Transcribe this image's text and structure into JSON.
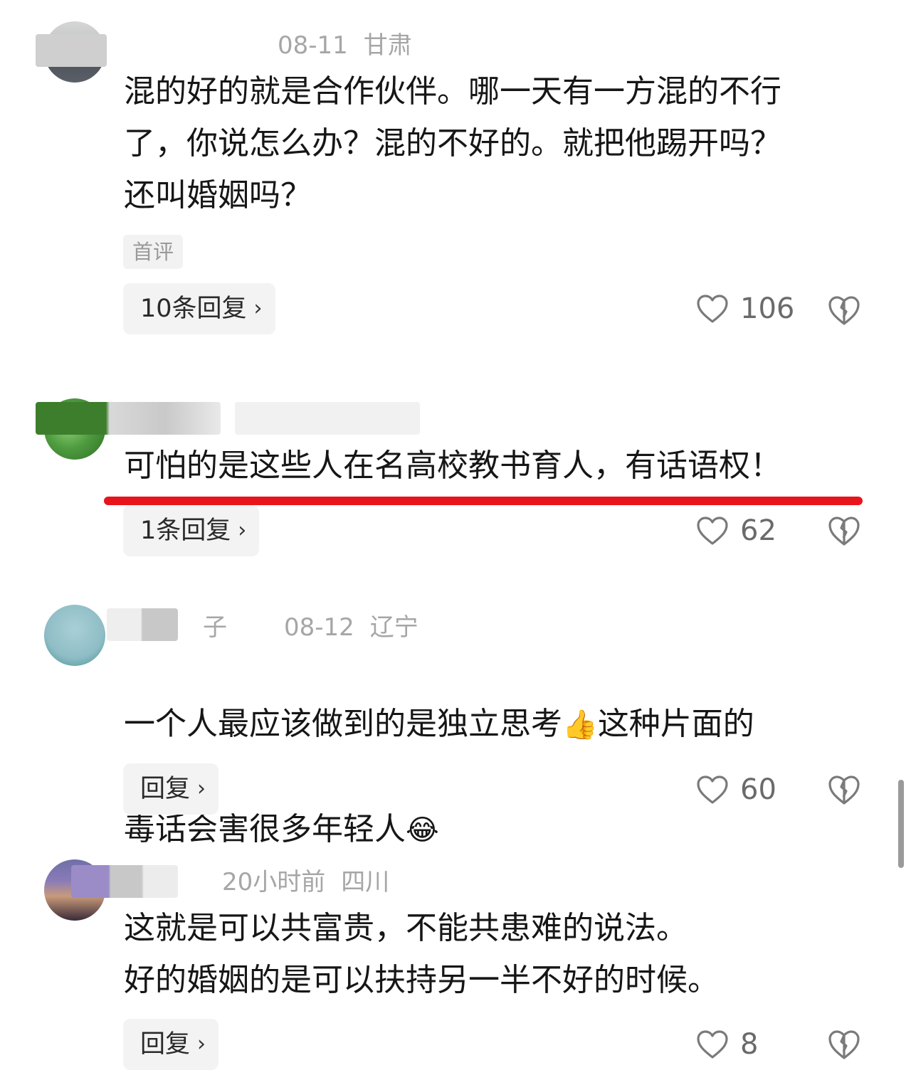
{
  "comments": [
    {
      "date": "08-11",
      "location": "甘肃",
      "text": "混的好的就是合作伙伴。哪一天有一方混的不行\n了，你说怎么办？混的不好的。就把他踢开吗？\n还叫婚姻吗？",
      "tag": "首评",
      "reply_label": "10条回复",
      "likes": "106"
    },
    {
      "text": "可怕的是这些人在名高校教书育人，有话语权！",
      "reply_label": "1条回复",
      "likes": "62"
    },
    {
      "name_fragment": "子",
      "date": "08-12",
      "location": "辽宁",
      "text_line1": "一个人最应该做到的是独立思考",
      "emoji1": "👍",
      "text_line1b": "这种片面的",
      "text_line2": "毒话会害很多年轻人",
      "emoji2": "😂",
      "reply_label": "回复",
      "likes": "60"
    },
    {
      "date": "20小时前",
      "location": "四川",
      "text": "这就是可以共富贵，不能共患难的说法。\n好的婚姻的是可以扶持另一半不好的时候。",
      "reply_label": "回复",
      "likes": "8"
    }
  ],
  "colors": {
    "highlight_line": "#e8141b",
    "meta_text": "#a6a6a6",
    "button_bg": "#f3f3f3"
  },
  "icons": {
    "like": "heart-outline-icon",
    "dislike": "broken-heart-icon",
    "chevron": "chevron-right-icon"
  }
}
